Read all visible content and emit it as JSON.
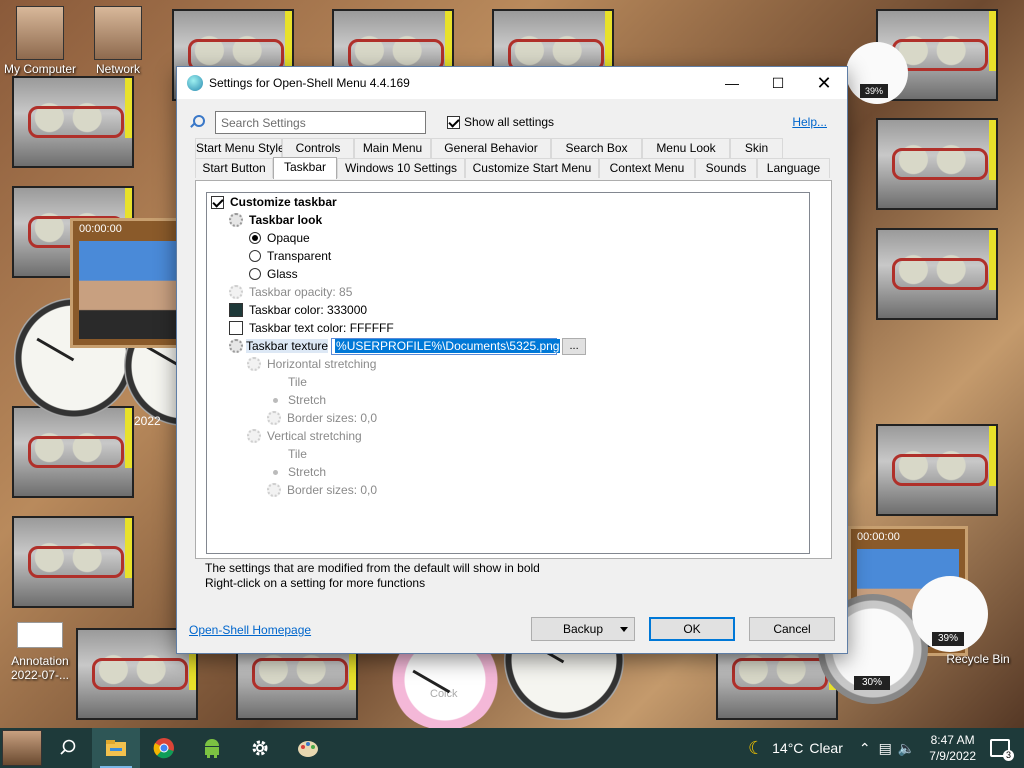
{
  "desktop": {
    "icons": [
      {
        "label": "My Computer"
      },
      {
        "label": "Network"
      },
      {
        "label": "Annotation 2022-07-..."
      },
      {
        "label": "Recycle Bin"
      }
    ],
    "puzzle_time": "00:00:00",
    "gauge_top": "39%",
    "gauge_left": "30%",
    "gauge_right": "39%",
    "clock_label": "Colck",
    "year_fragment": "2022"
  },
  "dialog": {
    "title": "Settings for Open-Shell Menu 4.4.169",
    "window_buttons": {
      "minimize": "—",
      "maximize": "☐",
      "close": "✕"
    },
    "search": {
      "placeholder": "Search Settings",
      "value": ""
    },
    "show_all_label": "Show all settings",
    "show_all_checked": true,
    "help_label": "Help...",
    "tabs_row1": [
      "Start Menu Style",
      "Controls",
      "Main Menu",
      "General Behavior",
      "Search Box",
      "Menu Look",
      "Skin"
    ],
    "tabs_row2": [
      "Start Button",
      "Taskbar",
      "Windows 10 Settings",
      "Customize Start Menu",
      "Context Menu",
      "Sounds",
      "Language"
    ],
    "active_tab": "Taskbar",
    "settings": {
      "customize_taskbar": "Customize taskbar",
      "taskbar_look": "Taskbar look",
      "opaque": "Opaque",
      "transparent": "Transparent",
      "glass": "Glass",
      "opacity": "Taskbar opacity: 85",
      "color": "Taskbar color: 333000",
      "text_color": "Taskbar text color: FFFFFF",
      "texture": "Taskbar texture",
      "texture_value": "%USERPROFILE%\\Documents\\5325.png",
      "browse": "...",
      "horizontal_stretching": "Horizontal stretching",
      "h_tile": "Tile",
      "h_stretch": "Stretch",
      "h_border": "Border sizes: 0,0",
      "vertical_stretching": "Vertical stretching",
      "v_tile": "Tile",
      "v_stretch": "Stretch",
      "v_border": "Border sizes: 0,0",
      "taskbar_color_hex": "#1f3a3a",
      "text_color_hex": "#ffffff"
    },
    "hint1": "The settings that are modified from the default will show in bold",
    "hint2": "Right-click on a setting for more functions",
    "homepage_label": "Open-Shell Homepage",
    "backup_label": "Backup",
    "ok_label": "OK",
    "cancel_label": "Cancel"
  },
  "taskbar": {
    "apps": [
      "search-icon",
      "file-explorer-icon",
      "chrome-icon",
      "android-icon",
      "settings-gear-icon",
      "paint-icon"
    ],
    "weather_temp": "14°C",
    "weather_desc": "Clear",
    "time": "8:47 AM",
    "date": "7/9/2022",
    "notification_count": "3"
  }
}
